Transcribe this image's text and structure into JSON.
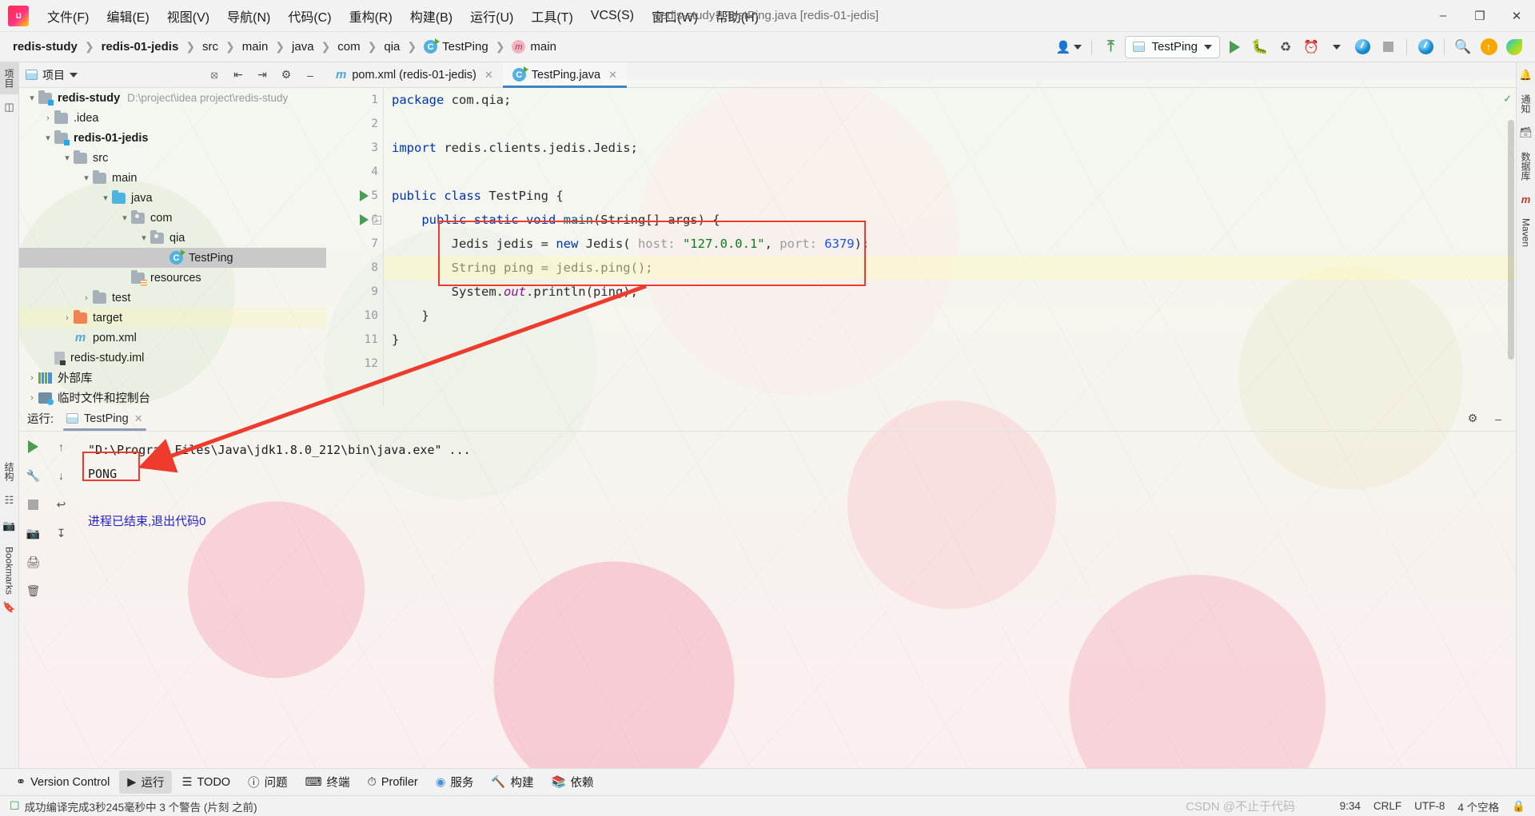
{
  "window": {
    "title": "redis-study - TestPing.java [redis-01-jedis]",
    "minimize": "–",
    "maximize": "❐",
    "close": "✕",
    "logo_text": "IJ"
  },
  "menu": [
    {
      "label": "文件(F)"
    },
    {
      "label": "编辑(E)"
    },
    {
      "label": "视图(V)"
    },
    {
      "label": "导航(N)"
    },
    {
      "label": "代码(C)"
    },
    {
      "label": "重构(R)"
    },
    {
      "label": "构建(B)"
    },
    {
      "label": "运行(U)"
    },
    {
      "label": "工具(T)"
    },
    {
      "label": "VCS(S)"
    },
    {
      "label": "窗口(W)"
    },
    {
      "label": "帮助(H)"
    }
  ],
  "breadcrumb": [
    {
      "label": "redis-study",
      "bold": true,
      "icon": ""
    },
    {
      "label": "redis-01-jedis",
      "bold": true,
      "icon": ""
    },
    {
      "label": "src",
      "bold": false,
      "icon": ""
    },
    {
      "label": "main",
      "bold": false,
      "icon": ""
    },
    {
      "label": "java",
      "bold": false,
      "icon": ""
    },
    {
      "label": "com",
      "bold": false,
      "icon": ""
    },
    {
      "label": "qia",
      "bold": false,
      "icon": ""
    },
    {
      "label": "TestPing",
      "bold": false,
      "icon": "class-icon"
    },
    {
      "label": "main",
      "bold": false,
      "icon": "method-icon"
    }
  ],
  "toolbar": {
    "run_config": "TestPing",
    "icons": [
      "user-icon",
      "chevron-down-icon",
      "vcs-update-icon",
      "run-icon",
      "debug-icon",
      "run-coverage-icon",
      "profiler-icon",
      "chevron-down-icon",
      "gauge-icon",
      "stop-icon",
      "gauge-plug-icon",
      "search-icon",
      "update-icon",
      "plugin-icon"
    ]
  },
  "left_strip": {
    "tabs": [
      "项目",
      "结构"
    ],
    "bookmarks": "Bookmarks"
  },
  "right_strip": {
    "tabs": [
      "通知",
      "数据库",
      "Maven"
    ]
  },
  "project_panel": {
    "title": "项目",
    "header_icons": [
      "locate-icon",
      "expand-all-icon",
      "collapse-all-icon",
      "gear-icon",
      "minimize-icon"
    ],
    "tree": [
      {
        "depth": 0,
        "arrow": "▾",
        "icon": "folder-module",
        "label": "redis-study",
        "bold": true,
        "path": "D:\\project\\idea project\\redis-study"
      },
      {
        "depth": 1,
        "arrow": "›",
        "icon": "folder",
        "label": ".idea",
        "bold": false,
        "path": ""
      },
      {
        "depth": 1,
        "arrow": "▾",
        "icon": "folder-module",
        "label": "redis-01-jedis",
        "bold": true,
        "path": ""
      },
      {
        "depth": 2,
        "arrow": "▾",
        "icon": "folder",
        "label": "src",
        "bold": false,
        "path": ""
      },
      {
        "depth": 3,
        "arrow": "▾",
        "icon": "folder",
        "label": "main",
        "bold": false,
        "path": ""
      },
      {
        "depth": 4,
        "arrow": "▾",
        "icon": "folder-source",
        "label": "java",
        "bold": false,
        "path": ""
      },
      {
        "depth": 5,
        "arrow": "▾",
        "icon": "folder-package",
        "label": "com",
        "bold": false,
        "path": ""
      },
      {
        "depth": 6,
        "arrow": "▾",
        "icon": "folder-package",
        "label": "qia",
        "bold": false,
        "path": ""
      },
      {
        "depth": 7,
        "arrow": "",
        "icon": "class-icon",
        "label": "TestPing",
        "bold": false,
        "path": "",
        "selected": true
      },
      {
        "depth": 4,
        "arrow": "",
        "icon": "folder-resources",
        "label": "resources",
        "bold": false,
        "path": ""
      },
      {
        "depth": 3,
        "arrow": "›",
        "icon": "folder",
        "label": "test",
        "bold": false,
        "path": ""
      },
      {
        "depth": 2,
        "arrow": "›",
        "icon": "folder-target",
        "label": "target",
        "bold": false,
        "path": ""
      },
      {
        "depth": 2,
        "arrow": "",
        "icon": "maven-icon",
        "label": "pom.xml",
        "bold": false,
        "path": ""
      },
      {
        "depth": 1,
        "arrow": "",
        "icon": "iml-icon",
        "label": "redis-study.iml",
        "bold": false,
        "path": ""
      },
      {
        "depth": 0,
        "arrow": "›",
        "icon": "library-icon",
        "label": "外部库",
        "bold": false,
        "path": ""
      },
      {
        "depth": 0,
        "arrow": "›",
        "icon": "scratch-icon",
        "label": "临时文件和控制台",
        "bold": false,
        "path": ""
      }
    ]
  },
  "editor": {
    "tabs": [
      {
        "label": "pom.xml (redis-01-jedis)",
        "icon": "maven-icon",
        "active": false,
        "close": "✕"
      },
      {
        "label": "TestPing.java",
        "icon": "class-icon",
        "active": true,
        "close": "✕"
      }
    ],
    "line_numbers": [
      "1",
      "2",
      "3",
      "4",
      "5",
      "6",
      "7",
      "8",
      "9",
      "10",
      "11",
      "12"
    ],
    "inspection_ok": "✓",
    "code_lines": [
      {
        "n": 1,
        "segments": [
          {
            "t": "package ",
            "c": "kw"
          },
          {
            "t": "com.qia;",
            "c": "plain"
          }
        ]
      },
      {
        "n": 2,
        "segments": []
      },
      {
        "n": 3,
        "segments": [
          {
            "t": "import ",
            "c": "kw"
          },
          {
            "t": "redis.clients.jedis.Jedis;",
            "c": "plain"
          }
        ]
      },
      {
        "n": 4,
        "segments": []
      },
      {
        "n": 5,
        "segments": [
          {
            "t": "public class ",
            "c": "kw"
          },
          {
            "t": "TestPing {",
            "c": "plain"
          }
        ],
        "gutter_run": true
      },
      {
        "n": 6,
        "segments": [
          {
            "t": "    ",
            "c": "plain"
          },
          {
            "t": "public static void ",
            "c": "kw"
          },
          {
            "t": "main",
            "c": "meth"
          },
          {
            "t": "(String[] args) {",
            "c": "plain"
          }
        ],
        "gutter_run": true,
        "gutter_fold": true
      },
      {
        "n": 7,
        "segments": [
          {
            "t": "        Jedis jedis = ",
            "c": "plain"
          },
          {
            "t": "new ",
            "c": "kw"
          },
          {
            "t": "Jedis( ",
            "c": "plain"
          },
          {
            "t": "host:",
            "c": "hint"
          },
          {
            "t": " \"127.0.0.1\"",
            "c": "str"
          },
          {
            "t": ", ",
            "c": "plain"
          },
          {
            "t": "port:",
            "c": "hint"
          },
          {
            "t": " 6379",
            "c": "num"
          },
          {
            "t": ");",
            "c": "plain"
          }
        ]
      },
      {
        "n": 8,
        "segments": [
          {
            "t": "        String ping = jedis.ping();",
            "c": "plain"
          }
        ]
      },
      {
        "n": 9,
        "segments": [
          {
            "t": "        System.",
            "c": "plain"
          },
          {
            "t": "out",
            "c": "fld"
          },
          {
            "t": ".println(ping);",
            "c": "plain"
          }
        ],
        "current": true
      },
      {
        "n": 10,
        "segments": [
          {
            "t": "    }",
            "c": "plain"
          }
        ]
      },
      {
        "n": 11,
        "segments": [
          {
            "t": "}",
            "c": "plain"
          }
        ]
      },
      {
        "n": 12,
        "segments": []
      }
    ]
  },
  "run_window": {
    "label": "运行:",
    "tab_name": "TestPing",
    "tab_close": "✕",
    "header_icons": [
      "gear-icon",
      "minimize-icon"
    ],
    "side_buttons": [
      "rerun-icon",
      "wrench-icon",
      "stop-icon",
      "camera-icon",
      "print-icon",
      "trash-icon",
      "up-icon",
      "down-icon",
      "soft-wrap-icon",
      "scroll-end-icon"
    ],
    "console_lines": [
      {
        "text": "\"D:\\Program Files\\Java\\jdk1.8.0_212\\bin\\java.exe\" ...",
        "kind": "plain"
      },
      {
        "text": "PONG",
        "kind": "plain"
      },
      {
        "text": "",
        "kind": "plain"
      },
      {
        "text": "进程已结束,退出代码0",
        "kind": "exit"
      }
    ]
  },
  "bottom_bar": [
    {
      "label": "Version Control",
      "icon": "branch-icon",
      "selected": false
    },
    {
      "label": "运行",
      "icon": "run-icon",
      "selected": true
    },
    {
      "label": "TODO",
      "icon": "todo-icon",
      "selected": false
    },
    {
      "label": "问题",
      "icon": "problems-icon",
      "selected": false
    },
    {
      "label": "终端",
      "icon": "terminal-icon",
      "selected": false
    },
    {
      "label": "Profiler",
      "icon": "profiler-icon",
      "selected": false
    },
    {
      "label": "服务",
      "icon": "services-icon",
      "selected": false
    },
    {
      "label": "构建",
      "icon": "build-icon",
      "selected": false
    },
    {
      "label": "依赖",
      "icon": "dependencies-icon",
      "selected": false
    }
  ],
  "status_bar": {
    "left_icon": "event-log-icon",
    "message": "成功编译完成3秒245毫秒中 3 个警告 (片刻 之前)",
    "position": "9:34",
    "line_sep": "CRLF",
    "encoding": "UTF-8",
    "indent": "4 个空格",
    "lock": "🔒",
    "watermark": "CSDN @不止于代码"
  },
  "colors": {
    "accent_blue": "#4083c9",
    "annotation_red": "#ef3b2d",
    "run_green": "#499c54",
    "keyword_blue": "#0033b3",
    "string_green": "#067d17",
    "number_blue": "#1750eb"
  }
}
